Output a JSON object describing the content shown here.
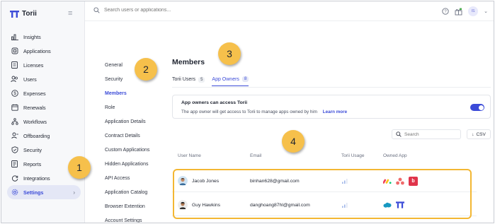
{
  "app": {
    "name": "Torii"
  },
  "topbar": {
    "search_placeholder": "Search users or applications...",
    "user_initials": "IS"
  },
  "sidebar": {
    "items": [
      {
        "label": "Insights",
        "icon": "chart-icon"
      },
      {
        "label": "Applications",
        "icon": "apps-icon"
      },
      {
        "label": "Licenses",
        "icon": "license-icon"
      },
      {
        "label": "Users",
        "icon": "users-icon"
      },
      {
        "label": "Expenses",
        "icon": "dollar-icon"
      },
      {
        "label": "Renewals",
        "icon": "calendar-icon"
      },
      {
        "label": "Workflows",
        "icon": "workflow-icon"
      },
      {
        "label": "Offboarding",
        "icon": "offboarding-icon"
      },
      {
        "label": "Security",
        "icon": "shield-icon"
      },
      {
        "label": "Reports",
        "icon": "report-icon"
      },
      {
        "label": "Integrations",
        "icon": "integrations-icon"
      },
      {
        "label": "Settings",
        "icon": "gear-icon",
        "active": true
      }
    ]
  },
  "settings_menu": {
    "items": [
      "General",
      "Security",
      "Members",
      "Role",
      "Application Details",
      "Contract Details",
      "Custom Applications",
      "Hidden Applications",
      "API Access",
      "Application Catalog",
      "Browser Extention",
      "Account Settings"
    ],
    "active": "Members"
  },
  "main": {
    "title": "Members",
    "tabs": [
      {
        "label": "Torii Users",
        "count": "5"
      },
      {
        "label": "App Owners",
        "count": "8",
        "active": true
      }
    ],
    "info": {
      "title": "App owners can access Torii",
      "description": "The app owner will get access to Torii to manage apps owned by him",
      "link": "Learn more"
    },
    "search_placeholder": "Search",
    "csv_label": "CSV",
    "columns": [
      "User Name",
      "Email",
      "Torii Usage",
      "Owned App"
    ],
    "rows": [
      {
        "name": "Jacob Jones",
        "email": "binhan628@gmail.com",
        "apps": [
          "monday-icon",
          "asana-icon",
          "bonusly-icon"
        ]
      },
      {
        "name": "Guy Hawkins",
        "email": "danghoang87hl@gmail.com",
        "apps": [
          "salesforce-icon",
          "torii-icon"
        ]
      }
    ]
  },
  "callouts": [
    "1",
    "2",
    "3",
    "4"
  ],
  "colors": {
    "accent": "#3b4bd8",
    "callout": "#f6c04b",
    "highlight": "#f3b733"
  }
}
